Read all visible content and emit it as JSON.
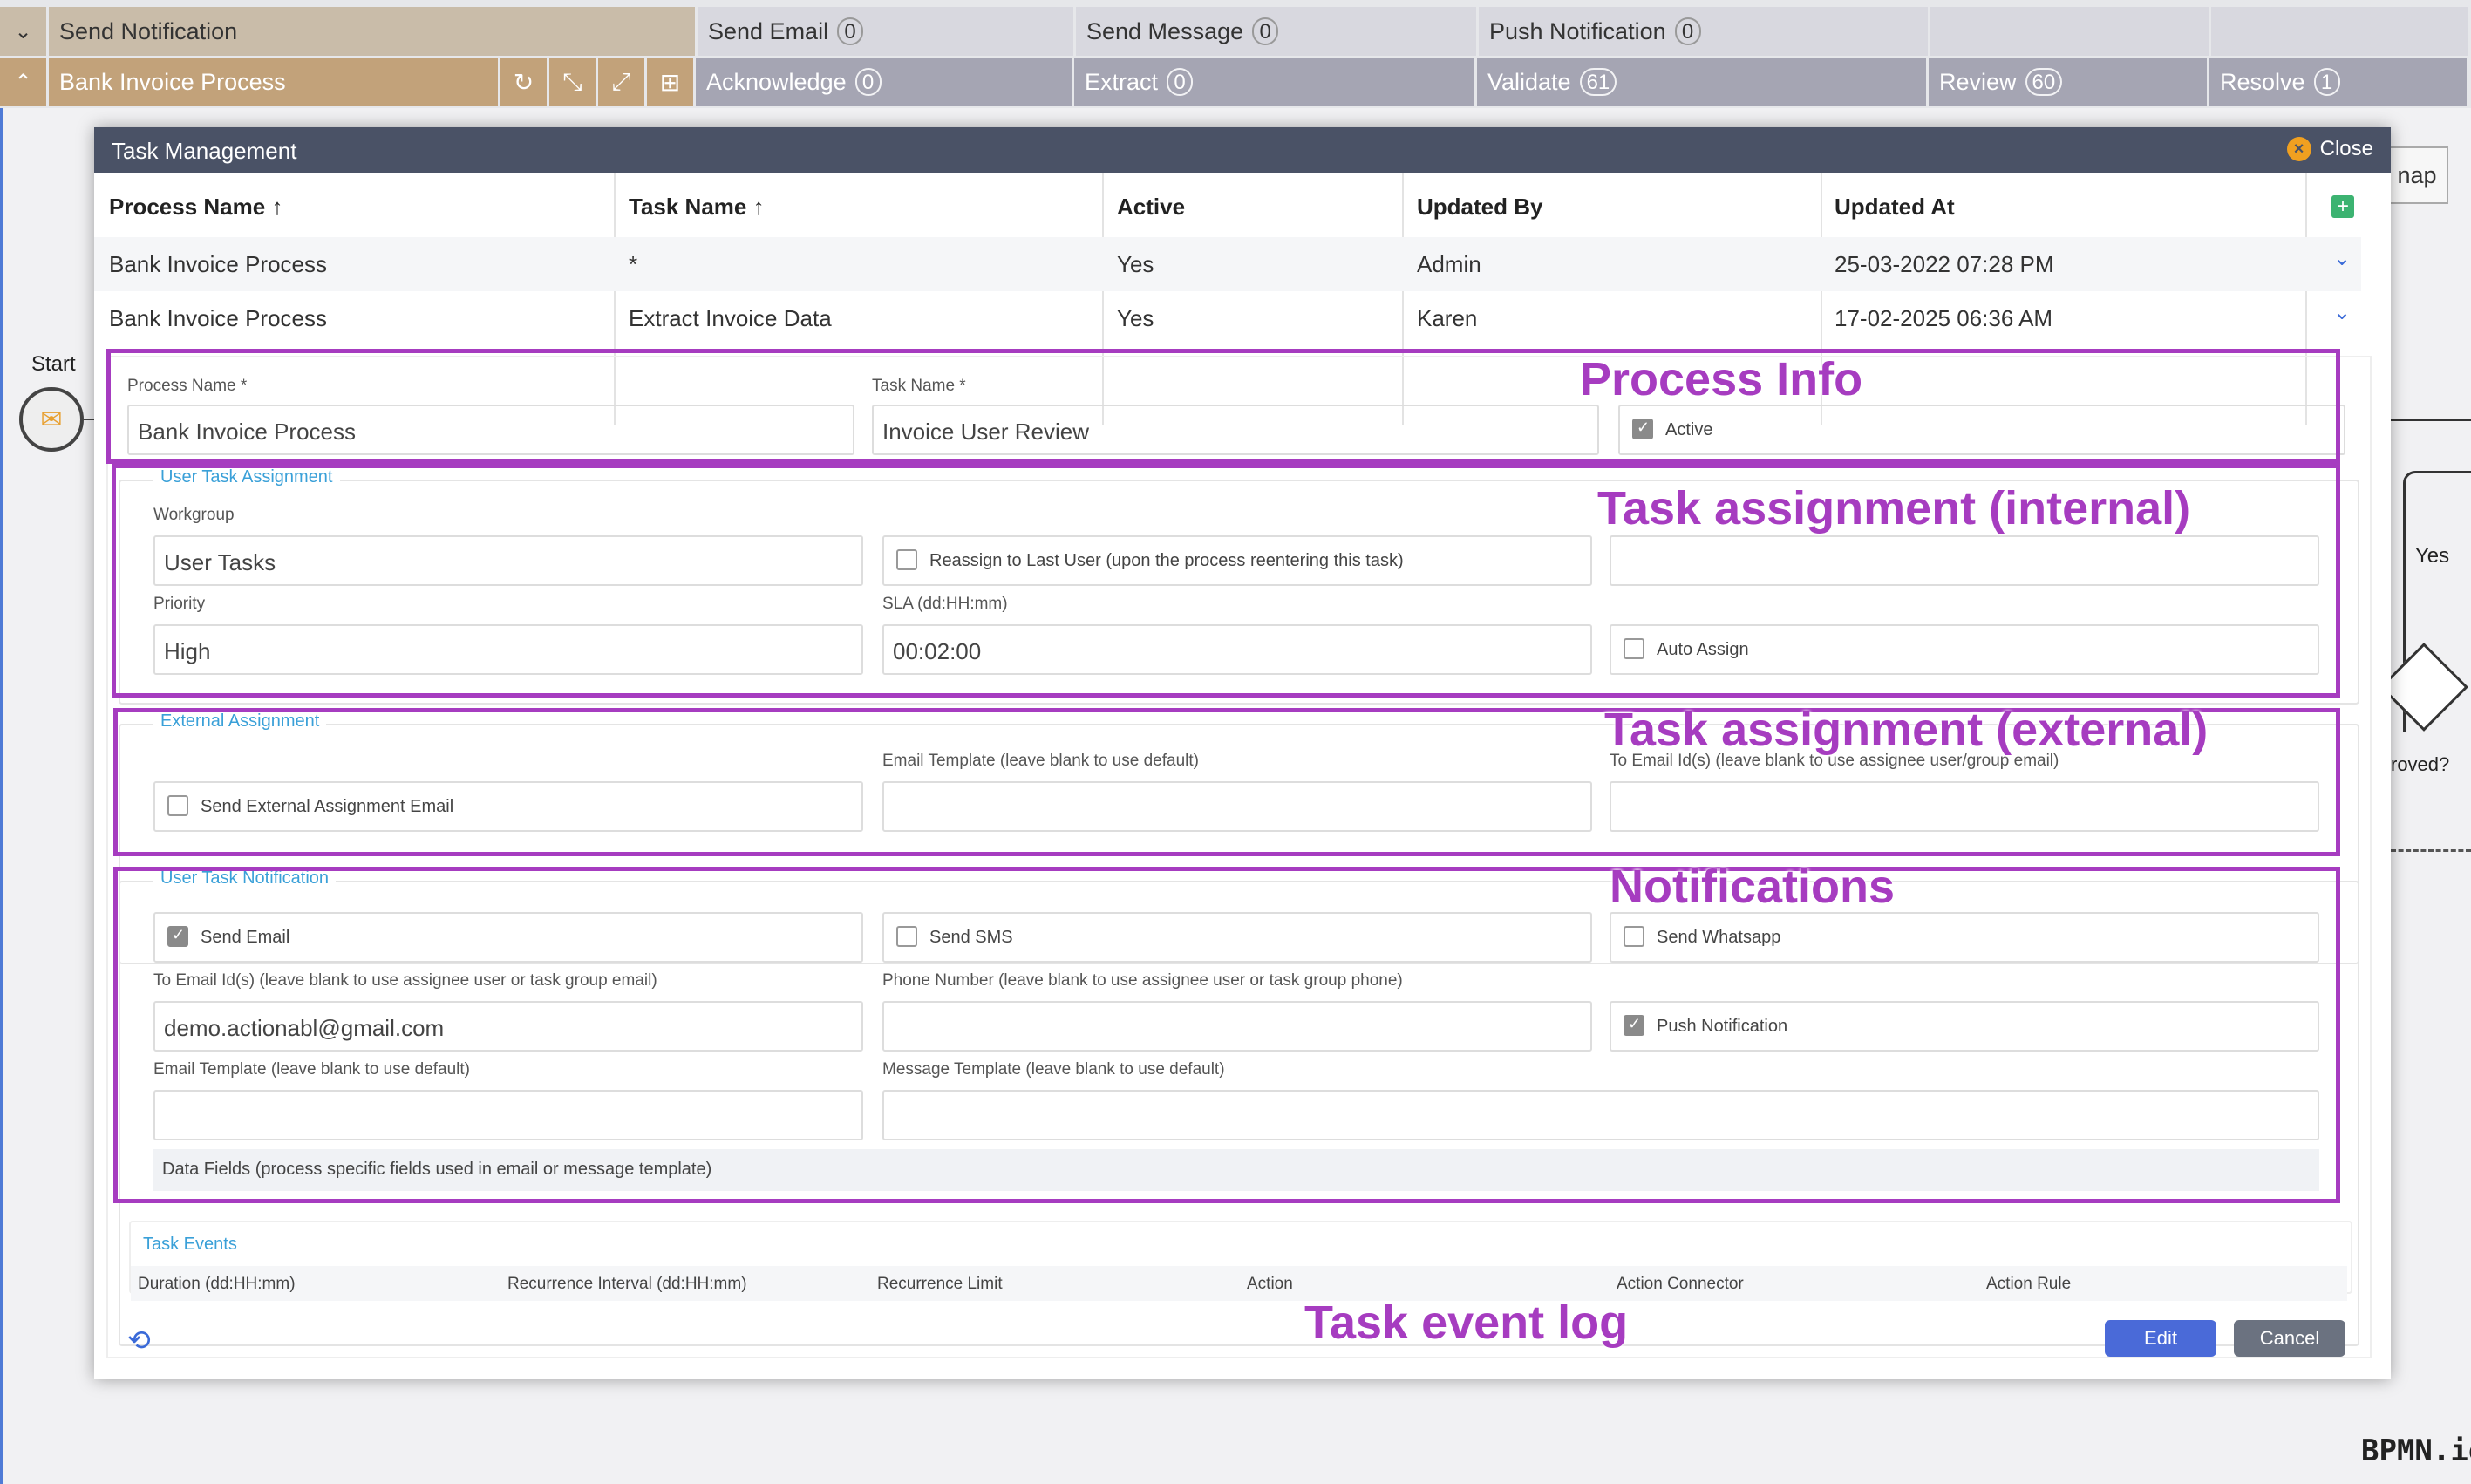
{
  "top_bar": {
    "row1": [
      {
        "label": "Send Notification"
      },
      {
        "label": "Send Email",
        "count": "0"
      },
      {
        "label": "Send Message",
        "count": "0"
      },
      {
        "label": "Push Notification",
        "count": "0"
      }
    ],
    "row2": [
      {
        "label": "Bank Invoice Process"
      },
      {
        "label": "Acknowledge",
        "count": "0"
      },
      {
        "label": "Extract",
        "count": "0"
      },
      {
        "label": "Validate",
        "count": "61"
      },
      {
        "label": "Review",
        "count": "60"
      },
      {
        "label": "Resolve",
        "count": "1"
      }
    ]
  },
  "canvas": {
    "start_label": "Start",
    "yes_label": "Yes",
    "approved_label": "roved?",
    "map_label": "nap",
    "watermark": "BPMN.io"
  },
  "modal": {
    "title": "Task Management",
    "close_label": "Close",
    "table": {
      "headers": [
        "Process Name",
        "Task Name",
        "Active",
        "Updated By",
        "Updated At"
      ],
      "rows": [
        {
          "process": "Bank Invoice Process",
          "task": "*",
          "active": "Yes",
          "updated_by": "Admin",
          "updated_at": "25-03-2022 07:28 PM"
        },
        {
          "process": "Bank Invoice Process",
          "task": "Extract Invoice Data",
          "active": "Yes",
          "updated_by": "Karen",
          "updated_at": "17-02-2025 06:36 AM"
        }
      ]
    },
    "form": {
      "process_name_label": "Process Name *",
      "process_name_value": "Bank Invoice Process",
      "task_name_label": "Task Name *",
      "task_name_value": "Invoice User Review",
      "active_label": "Active",
      "user_task_assignment_legend": "User Task Assignment",
      "workgroup_label": "Workgroup",
      "workgroup_value": "User Tasks",
      "reassign_label": "Reassign to Last User (upon the process reentering this task)",
      "priority_label": "Priority",
      "priority_value": "High",
      "sla_label": "SLA (dd:HH:mm)",
      "sla_value": "00:02:00",
      "auto_assign_label": "Auto Assign",
      "external_assignment_legend": "External Assignment",
      "ext_email_template_label": "Email Template (leave blank to use default)",
      "ext_to_email_label": "To Email Id(s) (leave blank to use assignee user/group email)",
      "send_external_email_label": "Send External Assignment Email",
      "notification_legend": "User Task Notification",
      "send_email_label": "Send Email",
      "send_sms_label": "Send SMS",
      "send_whatsapp_label": "Send Whatsapp",
      "to_email_label": "To Email Id(s) (leave blank to use assignee user or task group email)",
      "to_email_value": "demo.actionabl@gmail.com",
      "phone_label": "Phone Number (leave blank to use assignee user or task group phone)",
      "push_notification_label": "Push Notification",
      "email_template_label": "Email Template (leave blank to use default)",
      "message_template_label": "Message Template (leave blank to use default)",
      "data_fields_label": "Data Fields (process specific fields used in email or message template)",
      "task_events_legend": "Task Events",
      "events_headers": [
        "Duration (dd:HH:mm)",
        "Recurrence Interval (dd:HH:mm)",
        "Recurrence Limit",
        "Action",
        "Action Connector",
        "Action Rule"
      ],
      "edit_label": "Edit",
      "cancel_label": "Cancel"
    }
  },
  "annotations": {
    "process_info": "Process Info",
    "task_internal": "Task assignment (internal)",
    "task_external": "Task assignment (external)",
    "notifications": "Notifications",
    "event_log": "Task event log"
  },
  "colors": {
    "annotation": "#a63cc0",
    "header": "#4a5266",
    "accent": "#3aa0d8",
    "edit_button": "#4a6ad8",
    "cancel_button": "#6b7280"
  }
}
